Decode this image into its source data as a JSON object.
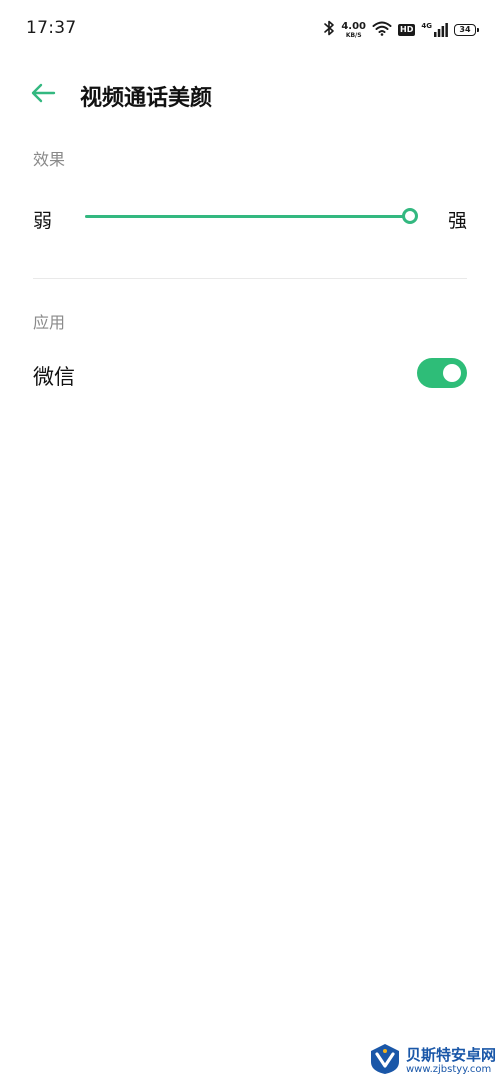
{
  "status_bar": {
    "time": "17:37",
    "net_speed_value": "4.00",
    "net_speed_unit": "KB/S",
    "hd_label": "HD",
    "network_type": "4G",
    "battery_level": "34"
  },
  "header": {
    "title": "视频通话美颜"
  },
  "effect_section": {
    "label": "效果",
    "slider": {
      "min_label": "弱",
      "max_label": "强",
      "value_fraction": 1.0
    }
  },
  "apps_section": {
    "label": "应用",
    "items": [
      {
        "label": "微信",
        "enabled": true
      }
    ]
  },
  "watermark": {
    "name": "贝斯特安卓网",
    "url": "www.zjbstyy.com"
  },
  "colors": {
    "accent": "#33b880",
    "toggle_on": "#2ebd78"
  }
}
